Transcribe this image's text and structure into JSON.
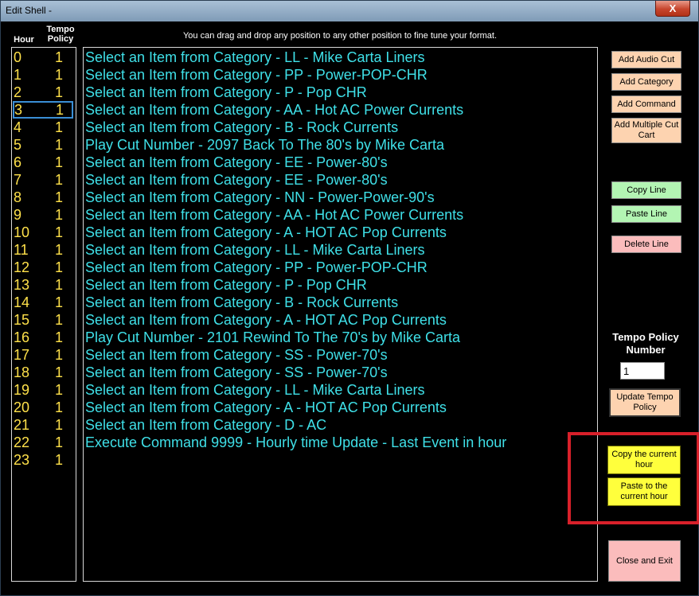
{
  "window": {
    "title": "Edit Shell -",
    "close_label": "X"
  },
  "headers": {
    "hour": "Hour",
    "tempo_policy": "Tempo\nPolicy"
  },
  "instruction": "You can drag and drop any position to any other position to fine tune your format.",
  "hours": [
    {
      "hour": "0",
      "tempo": "1"
    },
    {
      "hour": "1",
      "tempo": "1"
    },
    {
      "hour": "2",
      "tempo": "1"
    },
    {
      "hour": "3",
      "tempo": "1"
    },
    {
      "hour": "4",
      "tempo": "1"
    },
    {
      "hour": "5",
      "tempo": "1"
    },
    {
      "hour": "6",
      "tempo": "1"
    },
    {
      "hour": "7",
      "tempo": "1"
    },
    {
      "hour": "8",
      "tempo": "1"
    },
    {
      "hour": "9",
      "tempo": "1"
    },
    {
      "hour": "10",
      "tempo": "1"
    },
    {
      "hour": "11",
      "tempo": "1"
    },
    {
      "hour": "12",
      "tempo": "1"
    },
    {
      "hour": "13",
      "tempo": "1"
    },
    {
      "hour": "14",
      "tempo": "1"
    },
    {
      "hour": "15",
      "tempo": "1"
    },
    {
      "hour": "16",
      "tempo": "1"
    },
    {
      "hour": "17",
      "tempo": "1"
    },
    {
      "hour": "18",
      "tempo": "1"
    },
    {
      "hour": "19",
      "tempo": "1"
    },
    {
      "hour": "20",
      "tempo": "1"
    },
    {
      "hour": "21",
      "tempo": "1"
    },
    {
      "hour": "22",
      "tempo": "1"
    },
    {
      "hour": "23",
      "tempo": "1"
    }
  ],
  "selected_hour_index": 3,
  "items": [
    "Select an Item from Category - LL - Mike Carta Liners",
    "Select an Item from Category - PP - Power-POP-CHR",
    "Select an Item from Category - P - Pop CHR",
    "Select an Item from Category - AA - Hot AC Power Currents",
    "Select an Item from Category - B - Rock Currents",
    "Play Cut Number - 2097 Back To The 80's by Mike Carta",
    "Select an Item from Category - EE - Power-80's",
    "Select an Item from Category - EE - Power-80's",
    "Select an Item from Category - NN - Power-Power-90's",
    "Select an Item from Category - AA - Hot AC Power Currents",
    "Select an Item from Category - A - HOT AC Pop Currents",
    "Select an Item from Category - LL - Mike Carta Liners",
    "Select an Item from Category - PP - Power-POP-CHR",
    "Select an Item from Category - P - Pop CHR",
    "Select an Item from Category - B - Rock Currents",
    "Select an Item from Category - A - HOT AC Pop Currents",
    "Play Cut Number - 2101 Rewind To The 70's by Mike Carta",
    "Select an Item from Category - SS - Power-70's",
    "Select an Item from Category - SS - Power-70's",
    "Select an Item from Category - LL - Mike Carta Liners",
    "Select an Item from Category - A - HOT AC Pop Currents",
    "Select an Item from Category - D - AC",
    "Execute Command 9999 - Hourly time Update - Last Event in hour"
  ],
  "buttons": {
    "add_audio_cut": "Add Audio Cut",
    "add_category": "Add Category",
    "add_command": "Add Command",
    "add_multiple_cut_cart": "Add Multiple Cut Cart",
    "copy_line": "Copy Line",
    "paste_line": "Paste Line",
    "delete_line": "Delete Line",
    "update_tempo_policy": "Update Tempo Policy",
    "copy_current_hour": "Copy the current hour",
    "paste_current_hour": "Paste to the current hour",
    "close_and_exit": "Close and Exit"
  },
  "tempo_policy": {
    "label": "Tempo Policy Number",
    "value": "1"
  },
  "colors": {
    "hour_text": "#ffe14a",
    "item_text": "#3fe0e8",
    "highlight": "#d8202a"
  }
}
